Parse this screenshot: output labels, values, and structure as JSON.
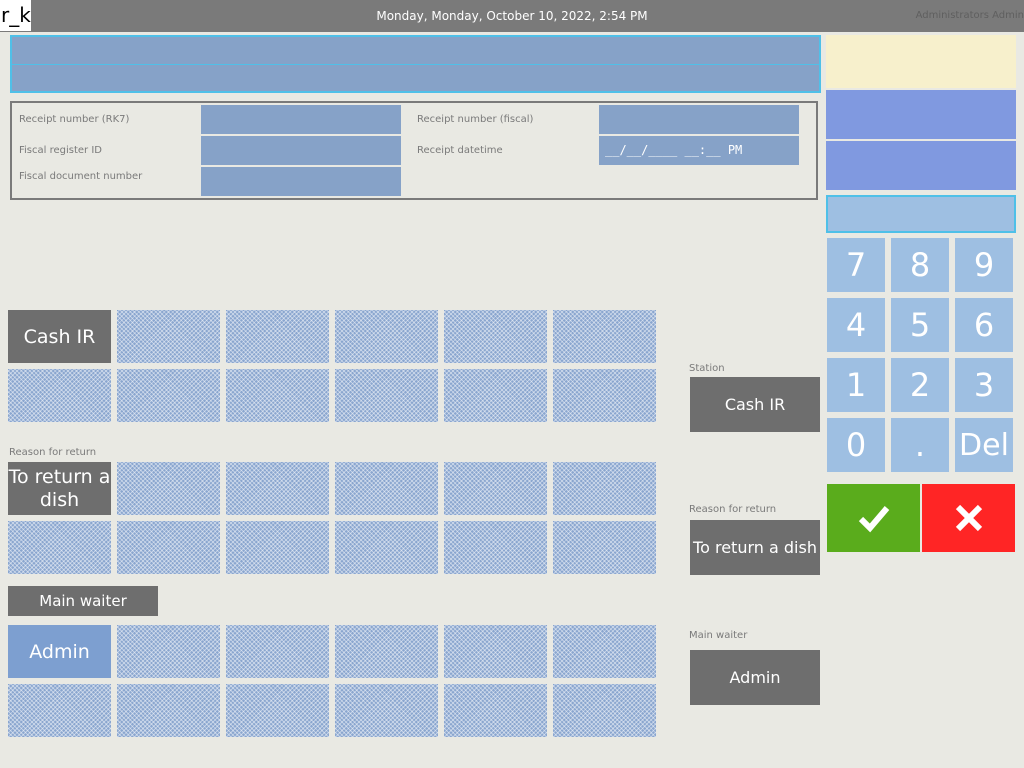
{
  "topbar": {
    "logo": "r_k",
    "datetime": "Monday, Monday, October 10, 2022, 2:54 PM",
    "user": "Administrators Admin"
  },
  "receipt": {
    "rk7_label": "Receipt number (RK7)",
    "fiscal_label": "Receipt number (fiscal)",
    "register_label": "Fiscal register ID",
    "datetime_label": "Receipt datetime",
    "docnum_label": "Fiscal document number",
    "datetime_mask": "__/__/____ __:__ PM"
  },
  "grid": {
    "station_selected": "Cash IR",
    "reason_label": "Reason for return",
    "reason_selected": "To return a dish",
    "waiter_label": "Main waiter",
    "waiter_selected": "Admin"
  },
  "summary": {
    "station_label": "Station",
    "station_value": "Cash IR",
    "reason_label": "Reason for return",
    "reason_value": "To return a dish",
    "waiter_label": "Main waiter",
    "waiter_value": "Admin"
  },
  "keypad": {
    "keys": [
      "7",
      "8",
      "9",
      "4",
      "5",
      "6",
      "1",
      "2",
      "3",
      "0",
      ".",
      "Del"
    ],
    "ok_icon": "check-icon",
    "cancel_icon": "close-icon"
  },
  "colors": {
    "accent": "#4fc0e8",
    "ok": "#5aac1c",
    "cancel": "#ff2525",
    "tile": "#8aa6cf",
    "button_dark": "#6e6e6e"
  }
}
